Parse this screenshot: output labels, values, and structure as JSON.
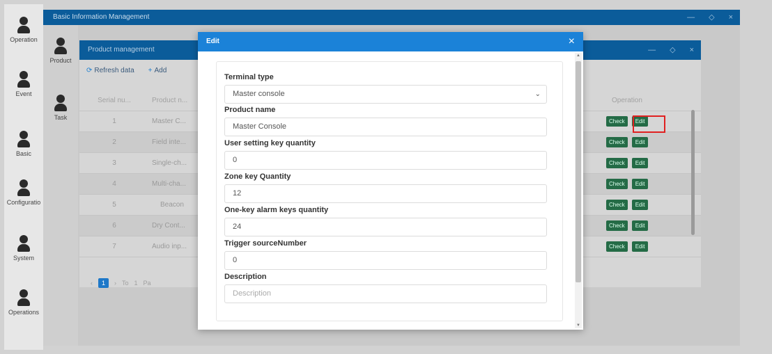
{
  "app_sidebar": {
    "items": [
      {
        "label": "Operation"
      },
      {
        "label": "Event"
      },
      {
        "label": "Basic"
      },
      {
        "label": "Configuratio"
      },
      {
        "label": "System"
      },
      {
        "label": "Operations"
      }
    ]
  },
  "outer_window": {
    "title": "Basic Information Management",
    "controls": {
      "minimize": "—",
      "restore": "◇",
      "close": "×"
    }
  },
  "inner_sidebar": {
    "items": [
      {
        "label": "Product"
      },
      {
        "label": "Task"
      }
    ]
  },
  "product_window": {
    "title": "Product management",
    "controls": {
      "minimize": "—",
      "restore": "◇",
      "close": "×"
    },
    "toolbar": {
      "refresh_label": "Refresh data",
      "add_label": "Add"
    },
    "table": {
      "headers": {
        "serial": "Serial nu...",
        "name": "Product n...",
        "operation": "Operation"
      },
      "rows": [
        {
          "serial": "1",
          "name": "Master C..."
        },
        {
          "serial": "2",
          "name": "Field inte..."
        },
        {
          "serial": "3",
          "name": "Single-ch..."
        },
        {
          "serial": "4",
          "name": "Multi-cha..."
        },
        {
          "serial": "5",
          "name": "Beacon"
        },
        {
          "serial": "6",
          "name": "Dry Cont..."
        },
        {
          "serial": "7",
          "name": "Audio inp..."
        }
      ],
      "check_label": "Check",
      "edit_label": "Edit"
    },
    "pager": {
      "prev": "‹",
      "current": "1",
      "next": "›",
      "to_label": "To",
      "page_input": "1",
      "page_label": "Pa"
    }
  },
  "edit_modal": {
    "title": "Edit",
    "close": "×",
    "fields": [
      {
        "label": "Terminal type",
        "value": "Master console",
        "type": "select"
      },
      {
        "label": "Product name",
        "value": "Master Console",
        "type": "text"
      },
      {
        "label": "User setting key quantity",
        "value": "0",
        "type": "text"
      },
      {
        "label": "Zone key Quantity",
        "value": "12",
        "type": "text"
      },
      {
        "label": "One-key alarm keys quantity",
        "value": "24",
        "type": "text"
      },
      {
        "label": "Trigger sourceNumber",
        "value": "0",
        "type": "text"
      },
      {
        "label": "Description",
        "value": "",
        "placeholder": "Description",
        "type": "text"
      }
    ]
  }
}
